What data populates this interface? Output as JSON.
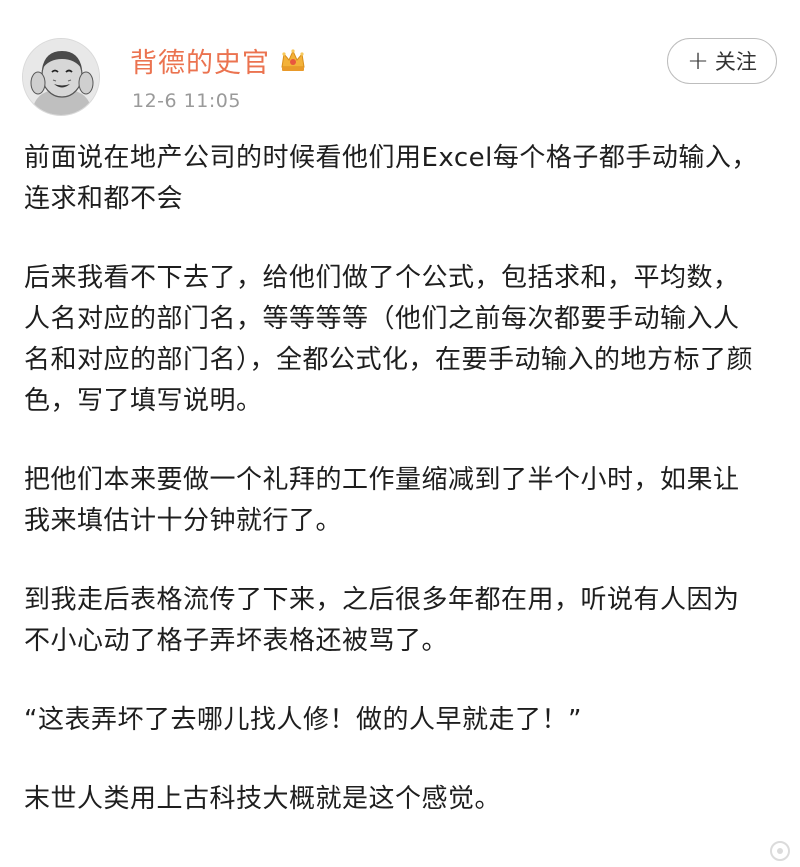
{
  "post": {
    "author": {
      "name": "背德的史官",
      "badge_icon": "crown-icon",
      "avatar_icon": "meme-face-avatar"
    },
    "timestamp": "12-6 11:05",
    "follow_button": {
      "plus": "+",
      "label": "关注"
    },
    "paragraphs": [
      "前面说在地产公司的时候看他们用Excel每个格子都手动输入，连求和都不会",
      "后来我看不下去了，给他们做了个公式，包括求和，平均数，人名对应的部门名，等等等等（他们之前每次都要手动输入人名和对应的部门名），全都公式化，在要手动输入的地方标了颜色，写了填写说明。",
      "把他们本来要做一个礼拜的工作量缩减到了半个小时，如果让我来填估计十分钟就行了。",
      "到我走后表格流传了下来，之后很多年都在用，听说有人因为不小心动了格子弄坏表格还被骂了。",
      "“这表弄坏了去哪儿找人修！做的人早就走了！”",
      "末世人类用上古科技大概就是这个感觉。"
    ]
  },
  "colors": {
    "author_name": "#eb7350",
    "timestamp": "#9a9a9a",
    "text": "#1e1e1e",
    "follow_border": "#bdbdbd"
  }
}
